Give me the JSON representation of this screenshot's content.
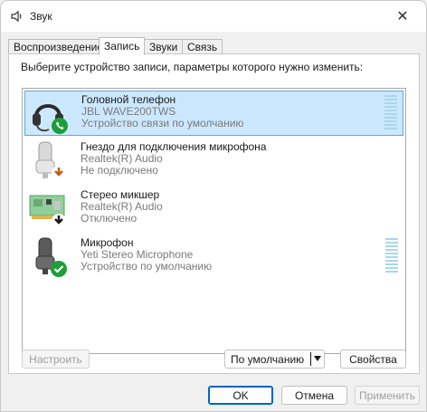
{
  "window": {
    "title": "Звук",
    "close_glyph": "✕"
  },
  "tabs": [
    {
      "label": "Воспроизведение",
      "active": false
    },
    {
      "label": "Запись",
      "active": true
    },
    {
      "label": "Звуки",
      "active": false
    },
    {
      "label": "Связь",
      "active": false
    }
  ],
  "instruction": "Выберите устройство записи, параметры которого нужно изменить:",
  "devices": [
    {
      "name": "Головной телефон",
      "driver": "JBL WAVE200TWS",
      "status": "Устройство связи по умолчанию",
      "icon": "headset-icon",
      "badge": "phone-badge-icon",
      "selected": true
    },
    {
      "name": "Гнездо для подключения микрофона",
      "driver": "Realtek(R) Audio",
      "status": "Не подключено",
      "icon": "microphone-icon",
      "badge": "unplugged-badge-icon",
      "selected": false
    },
    {
      "name": "Стерео микшер",
      "driver": "Realtek(R) Audio",
      "status": "Отключено",
      "icon": "sound-card-icon",
      "badge": "disabled-badge-icon",
      "selected": false
    },
    {
      "name": "Микрофон",
      "driver": "Yeti Stereo Microphone",
      "status": "Устройство по умолчанию",
      "icon": "microphone-icon",
      "badge": "default-check-badge-icon",
      "selected": false
    }
  ],
  "buttons": {
    "configure": "Настроить",
    "set_default": "По умолчанию",
    "properties": "Свойства",
    "ok": "OK",
    "cancel": "Отмена",
    "apply": "Применить"
  },
  "colors": {
    "accent": "#0067c0",
    "selection": "#cce8ff",
    "check_green": "#1e9e3a",
    "meter": "#a8d8ea"
  }
}
